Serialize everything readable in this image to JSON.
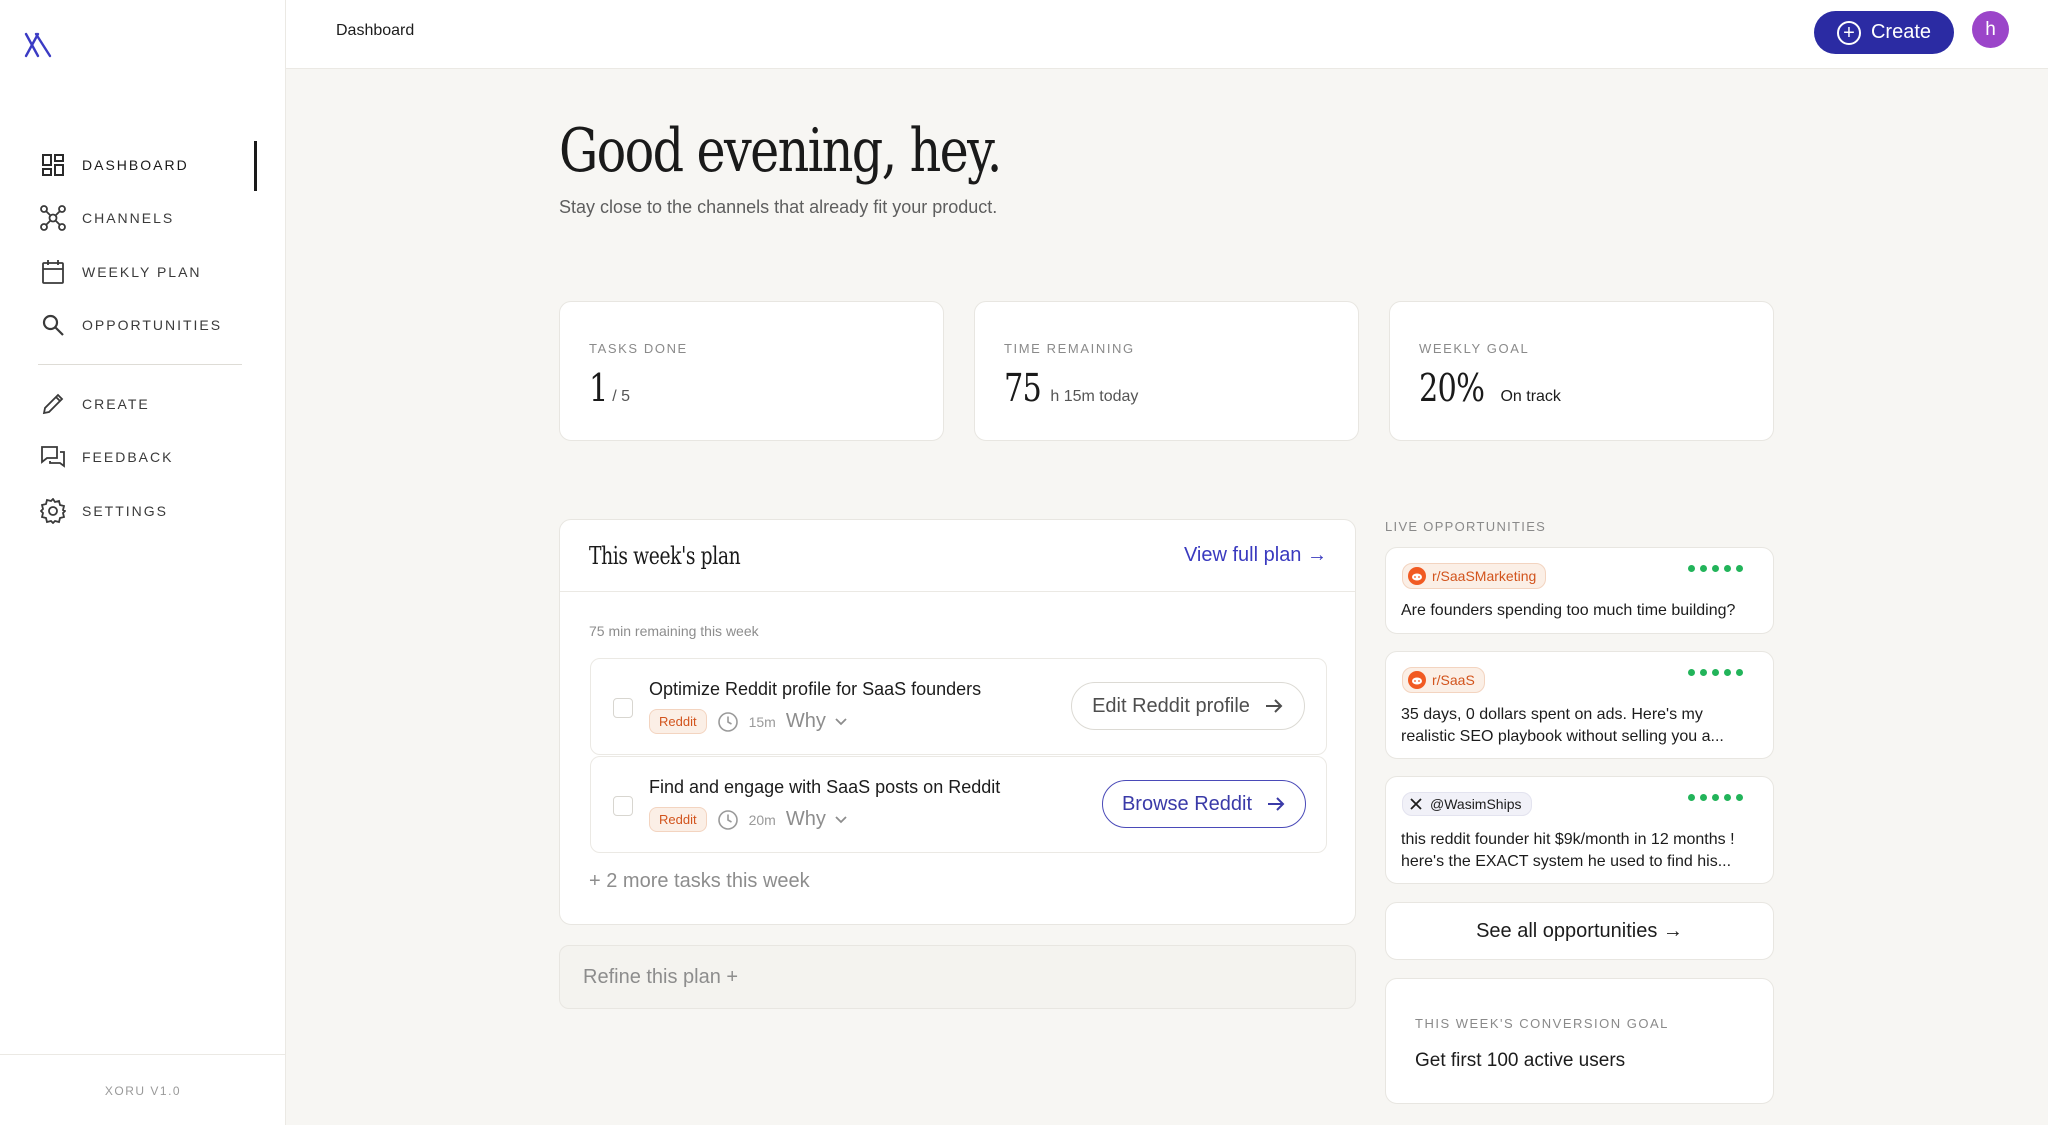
{
  "sidebar": {
    "logo": "xoru-logo",
    "items": [
      {
        "label": "DASHBOARD",
        "icon": "dashboard-icon",
        "active": true
      },
      {
        "label": "CHANNELS",
        "icon": "channels-icon"
      },
      {
        "label": "WEEKLY PLAN",
        "icon": "calendar-icon"
      },
      {
        "label": "OPPORTUNITIES",
        "icon": "search-icon"
      },
      {
        "label": "CREATE",
        "icon": "pencil-icon"
      },
      {
        "label": "FEEDBACK",
        "icon": "chat-icon"
      },
      {
        "label": "SETTINGS",
        "icon": "gear-icon"
      }
    ],
    "version": "XORU V1.0"
  },
  "topbar": {
    "breadcrumb": "Dashboard",
    "create_label": "Create",
    "avatar_initial": "h"
  },
  "greeting": {
    "title": "Good evening, hey.",
    "subtitle": "Stay close to the channels that already fit your product."
  },
  "stats": [
    {
      "label": "TASKS DONE",
      "value": "1",
      "suffix": "/ 5"
    },
    {
      "label": "TIME REMAINING",
      "value": "75",
      "suffix": "h 15m today"
    },
    {
      "label": "WEEKLY GOAL",
      "value": "20%",
      "suffix": "On track"
    }
  ],
  "plan": {
    "title": "This week's plan",
    "view_full": "View full plan →",
    "remaining": "75 min remaining this week",
    "tasks": [
      {
        "name": "Optimize Reddit profile for SaaS founders",
        "tag": "Reddit",
        "duration": "15m",
        "why": "Why",
        "action": "Edit Reddit profile"
      },
      {
        "name": "Find and engage with SaaS posts on Reddit",
        "tag": "Reddit",
        "duration": "20m",
        "why": "Why",
        "action": "Browse Reddit"
      }
    ],
    "more": "+ 2 more tasks this week",
    "refine": "Refine this plan +"
  },
  "opportunities": {
    "label": "LIVE OPPORTUNITIES",
    "items": [
      {
        "source": "r/SaaSMarketing",
        "type": "reddit",
        "text": "Are founders spending too much time building?"
      },
      {
        "source": "r/SaaS",
        "type": "reddit",
        "text": "35 days, 0 dollars spent on ads. Here's my realistic SEO playbook without selling you a..."
      },
      {
        "source": "@WasimShips",
        "type": "x",
        "text": "this reddit founder hit $9k/month in 12 months ! here's the EXACT system he used to find his..."
      }
    ],
    "see_all": "See all opportunities →"
  },
  "goal": {
    "label": "THIS WEEK'S CONVERSION GOAL",
    "value": "Get first 100 active users"
  },
  "colors": {
    "accent": "#2b2ba3",
    "avatar": "#9b45c9",
    "reddit": "#d2541d",
    "live_dot": "#22b45a"
  }
}
